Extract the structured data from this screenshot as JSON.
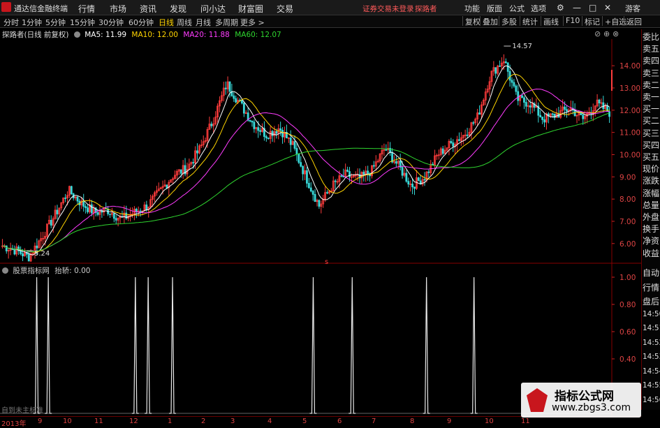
{
  "app": {
    "name": "通达信金融终端",
    "notice": "证券交易未登录",
    "user": "探路者",
    "guest": "游客"
  },
  "menu": [
    "行情",
    "市场",
    "资讯",
    "发现",
    "问小达",
    "财富圈",
    "交易"
  ],
  "menu_right": [
    "功能",
    "版面",
    "公式",
    "选项"
  ],
  "periods": [
    "分时",
    "1分钟",
    "5分钟",
    "15分钟",
    "30分钟",
    "60分钟",
    "日线",
    "周线",
    "月线",
    "多周期",
    "更多 >"
  ],
  "active_period": "日线",
  "right_tools": [
    "复权",
    "叠加",
    "多股",
    "统计",
    "画线",
    "F10",
    "标记",
    "+自选",
    "返回"
  ],
  "stock": {
    "title": "探路者(日线 前复权)"
  },
  "ma": [
    {
      "label": "MA5: 11.99",
      "color": "#ffffff"
    },
    {
      "label": "MA10: 12.00",
      "color": "#ffd400"
    },
    {
      "label": "MA20: 11.88",
      "color": "#ff3cff"
    },
    {
      "label": "MA60: 12.07",
      "color": "#2fd52f"
    }
  ],
  "annotations": {
    "high": "14.57",
    "low": "5.24",
    "marker": "s"
  },
  "y_axis_price": [
    "14.00",
    "13.00",
    "12.00",
    "11.00",
    "10.00",
    "9.00",
    "8.00",
    "7.00",
    "6.00"
  ],
  "y_axis_indicator": [
    "1.00",
    "0.80",
    "0.60",
    "0.40"
  ],
  "side_panel": [
    "委比",
    "卖五",
    "卖四",
    "卖三",
    "卖二",
    "卖一",
    "买一",
    "买二",
    "买三",
    "买四",
    "买五",
    "现价",
    "涨跌",
    "涨幅",
    "总量",
    "外盘",
    "换手",
    "净资",
    "收益",
    "自动",
    "行情",
    "盘后",
    "14:50",
    "14:51",
    "14:52",
    "14:53",
    "14:54",
    "14:55",
    "14:56"
  ],
  "indicator": {
    "name": "股票指标网",
    "value": "抬轿: 0.00"
  },
  "footer_note": "自到未主标准",
  "x_axis": [
    "2013年",
    "9",
    "10",
    "11",
    "12",
    "1",
    "2",
    "3",
    "4",
    "5",
    "6",
    "7",
    "8",
    "9",
    "10",
    "11"
  ],
  "stamp": {
    "title": "指标公式网",
    "url": "www.zbgs3.com"
  },
  "chart_data": {
    "type": "candlestick",
    "ylim": [
      5.0,
      15.0
    ],
    "close_path": [
      5.9,
      5.7,
      5.4,
      6.3,
      7.3,
      8.4,
      7.8,
      7.4,
      7.5,
      7.1,
      7.4,
      7.7,
      8.4,
      9.1,
      9.4,
      10.3,
      11.6,
      13.2,
      12.3,
      11.4,
      10.9,
      11.2,
      10.4,
      9.0,
      7.7,
      8.6,
      9.1,
      8.9,
      9.3,
      10.3,
      9.5,
      8.6,
      9.0,
      10.0,
      10.5,
      10.9,
      11.7,
      13.6,
      14.3,
      12.5,
      12.3,
      11.6,
      11.8,
      12.1,
      11.6,
      12.3,
      11.9
    ],
    "signals_x_fraction": [
      0.058,
      0.077,
      0.22,
      0.241,
      0.281,
      0.512,
      0.576,
      0.698,
      0.776
    ],
    "signal_value": 1.0
  }
}
